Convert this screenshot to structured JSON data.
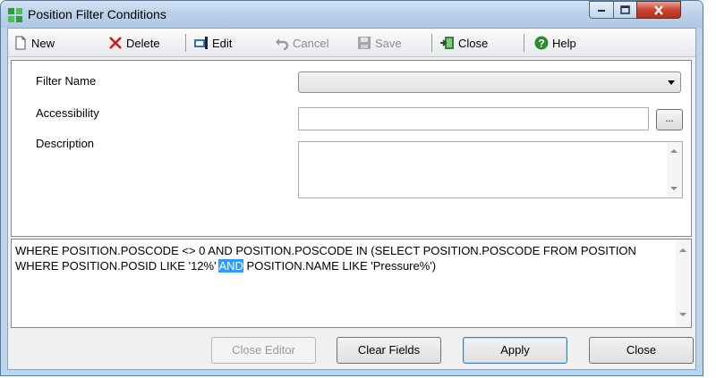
{
  "window": {
    "title": "Position Filter Conditions"
  },
  "toolbar": {
    "new_label": "New",
    "delete_label": "Delete",
    "edit_label": "Edit",
    "cancel_label": "Cancel",
    "save_label": "Save",
    "close_label": "Close",
    "help_label": "Help"
  },
  "form": {
    "filter_name_label": "Filter Name",
    "filter_name_value": "",
    "accessibility_label": "Accessibility",
    "accessibility_value": "",
    "ellipsis_label": "...",
    "description_label": "Description",
    "description_value": ""
  },
  "sql": {
    "before": "WHERE POSITION.POSCODE <> 0 AND POSITION.POSCODE IN (SELECT POSITION.POSCODE FROM POSITION WHERE POSITION.POSID LIKE '12%' ",
    "highlight": "AND",
    "after": " POSITION.NAME LIKE 'Pressure%')"
  },
  "buttons": {
    "close_editor": "Close Editor",
    "clear_fields": "Clear Fields",
    "apply": "Apply",
    "close": "Close"
  },
  "icons": {
    "app": "position-filter-icon",
    "new": "new-document-icon",
    "delete": "red-x-icon",
    "edit": "edit-icon",
    "cancel": "undo-icon",
    "save": "save-icon",
    "close": "exit-door-icon",
    "help": "help-icon"
  }
}
